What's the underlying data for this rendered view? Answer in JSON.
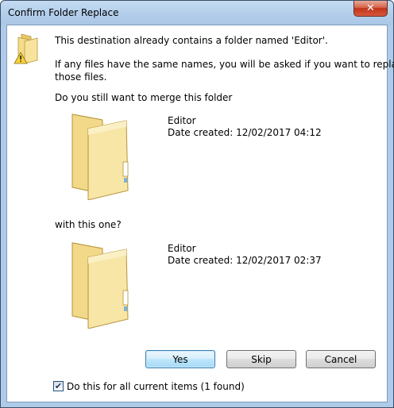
{
  "window": {
    "title": "Confirm Folder Replace",
    "close_glyph": "✕"
  },
  "icons": {
    "header": "folder-warning-icon",
    "folder": "folder-icon",
    "close": "close-icon",
    "check": "checkmark-icon"
  },
  "message": {
    "line1": "This destination already contains a folder named 'Editor'.",
    "line2": "If any files have the same names, you will be asked if you want to replace",
    "line3": "those files.",
    "question": "Do you still want to merge this folder",
    "with_this": "with this one?"
  },
  "source_folder": {
    "name": "Editor",
    "date_created": "Date created: 12/02/2017 04:12"
  },
  "dest_folder": {
    "name": "Editor",
    "date_created": "Date created: 12/02/2017 02:37"
  },
  "buttons": {
    "yes": "Yes",
    "skip": "Skip",
    "cancel": "Cancel"
  },
  "checkbox": {
    "label": "Do this for all current items (1 found)",
    "checked": true,
    "mark": "✔"
  }
}
